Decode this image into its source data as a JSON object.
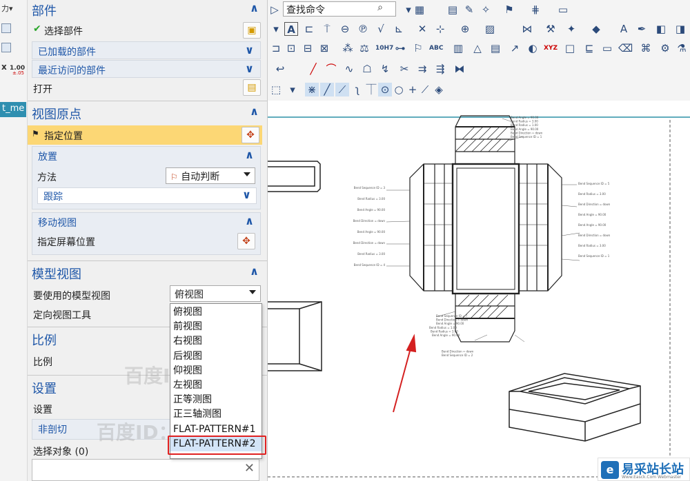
{
  "left_strip": {
    "top_label": "力▾",
    "tab_fragment": "t_me",
    "ruler_value": "1.00",
    "ruler_tol": "±.05",
    "x_label": "x"
  },
  "dialog": {
    "parts": {
      "title": "部件",
      "select_label": "选择部件",
      "loaded": "已加载的部件",
      "recent": "最近访问的部件",
      "open": "打开"
    },
    "view_origin": {
      "title": "视图原点",
      "specify_location": "指定位置",
      "placement": "放置",
      "method_label": "方法",
      "method_value": "自动判断",
      "track": "跟踪",
      "move_view": "移动视图",
      "specify_screen": "指定屏幕位置"
    },
    "model_view": {
      "title": "模型视图",
      "use_label": "要使用的模型视图",
      "use_value": "俯视图",
      "orient_tool": "定向视图工具"
    },
    "scale": {
      "title": "比例",
      "label": "比例"
    },
    "settings": {
      "title": "设置",
      "label": "设置",
      "non_section": "非剖切",
      "select_objects": "选择对象 (0)"
    },
    "dropdown_options": [
      "俯视图",
      "前视图",
      "右视图",
      "后视图",
      "仰视图",
      "左视图",
      "正等测图",
      "正三轴测图",
      "FLAT-PATTERN#1",
      "FLAT-PATTERN#2"
    ],
    "dropdown_selected_index": 9
  },
  "toolbar": {
    "search_value": "查找命令",
    "abc_label": "ABC",
    "h7_label": "10H7",
    "xyz_label": "XYZ"
  },
  "watermarks": {
    "w1": "百度ID：ffjczr",
    "w2": "百度ID：ffjczr"
  },
  "drawing_notes": {
    "top": [
      "Bend Angle = 90.00",
      "Bend Radius = 3.00",
      "Bend Radius = 1.00",
      "Bend Angle = 90.00",
      "Bend Direction = down",
      "Bend Sequence ID = 1"
    ],
    "left": [
      "Bend Sequence ID = 3",
      "Bend Radius = 3.00",
      "Bend Angle = 90.00",
      "Bend Direction = down",
      "Bend Angle = 90.00",
      "Bend Direction = down",
      "Bend Radius = 3.00",
      "Bend Sequence ID = 4"
    ],
    "right": [
      "Bend Sequence ID = 5",
      "Bend Radius = 3.00",
      "Bend Direction = down",
      "Bend Angle = 90.00",
      "Bend Angle = 90.00",
      "Bend Direction = down",
      "Bend Radius = 3.00",
      "Bend Sequence ID = 1"
    ],
    "bottom": [
      "Bend Sequence ID = 7",
      "Bend Direction = down",
      "Bend Angle = 90.00",
      "Bend Radius = 1.00",
      "Bend Radius = 3.00",
      "Bend Angle = 90.00",
      "Bend Direction = down",
      "Bend Sequence ID = 2"
    ]
  },
  "logo": {
    "name": "易采站长站",
    "url": "Www.Easck.Com Webmaster",
    "mark": "e"
  },
  "colors": {
    "accent": "#1f57a8",
    "highlight": "#fcd775",
    "annotation_red": "#e02020",
    "arrow_red": "#d42020"
  }
}
